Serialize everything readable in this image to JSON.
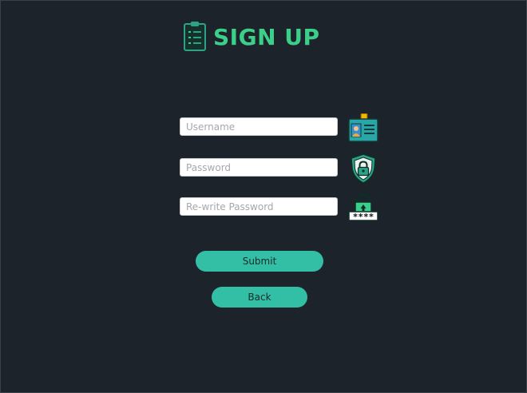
{
  "header": {
    "title": "SIGN UP",
    "icon": "clipboard-checklist-icon"
  },
  "form": {
    "username": {
      "placeholder": "Username",
      "value": "",
      "icon": "id-card-icon"
    },
    "password": {
      "placeholder": "Password",
      "value": "",
      "icon": "shield-lock-icon"
    },
    "rewrite_password": {
      "placeholder": "Re-write Password",
      "value": "",
      "icon": "padlock-password-icon",
      "mask_text": "****"
    }
  },
  "buttons": {
    "submit_label": "Submit",
    "back_label": "Back"
  },
  "colors": {
    "background": "#1d232a",
    "accent_title": "#3ccf8a",
    "button_bg": "#33bfa5"
  }
}
